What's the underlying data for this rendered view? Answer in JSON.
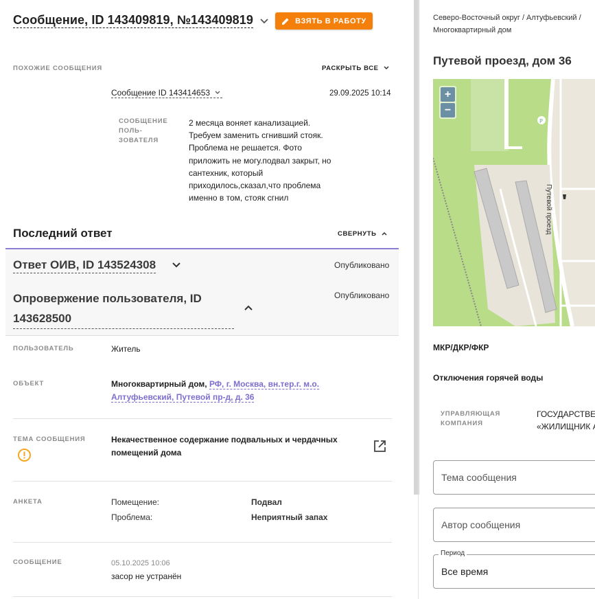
{
  "header": {
    "title": "Сообщение, ID 143409819, №143409819",
    "take_button": "ВЗЯТЬ В РАБОТУ"
  },
  "similar": {
    "label": "ПОХОЖИЕ СООБЩЕНИЯ",
    "expand_all": "РАСКРЫТЬ ВСЕ",
    "item_link": "Сообщение ID 143414653",
    "item_date": "29.09.2025 10:14",
    "user_msg_label": "СООБЩЕНИЕ ПОЛЬ-ЗОВАТЕЛЯ",
    "user_msg_text": "2 месяца воняет канализацией. Требуем заменить сгнивший стояк. Проблема не решается. Фото приложить не могу.подвал закрыт, но сантехник, который приходилось,сказал,что проблема именно в том, стояк сгнил"
  },
  "last_answer": {
    "title": "Последний ответ",
    "collapse": "СВЕРНУТЬ",
    "answer1_title": "Ответ ОИВ, ID 143524308",
    "answer1_status": "Опубликовано",
    "answer2_title": "Опровержение пользователя, ID 143628500",
    "answer2_status": "Опубликовано"
  },
  "details": {
    "user_label": "ПОЛЬЗОВАТЕЛЬ",
    "user_value": "Житель",
    "object_label": "ОБЪЕКТ",
    "object_type": "Многоквартирный дом, ",
    "object_address": "РФ, г. Москва, вн.тер.г. м.о. Алтуфьевский, Путевой пр-д, д. 36",
    "topic_label": "ТЕМА СООБЩЕНИЯ",
    "topic_value": "Некачественное содержание подвальных и чердачных помещений дома",
    "survey_label": "АНКЕТА",
    "survey_key1": "Помещение:",
    "survey_val1": "Подвал",
    "survey_key2": "Проблема:",
    "survey_val2": "Неприятный запах",
    "message_label": "СООБЩЕНИЕ",
    "message_date": "05.10.2025 10:06",
    "message_text": "засор не устранён"
  },
  "right": {
    "breadcrumb": "Северо-Восточный округ / Алтуфьевский / Многоквартирный дом",
    "address": "Путевой проезд, дом 36",
    "map_street": "Путевой проезд",
    "zoom_in": "+",
    "zoom_out": "−",
    "mkr": "МКР/ДКР/ФКР",
    "hot_water": "Отключения горячей воды",
    "mgmt_label": "УПРАВЛЯЮЩАЯ КОМПАНИЯ",
    "mgmt_value_line1": "ГОСУДАРСТВЕ",
    "mgmt_value_line2": "«ЖИЛИЩНИК А",
    "topic_placeholder": "Тема сообщения",
    "author_placeholder": "Автор сообщения",
    "period_label": "Период",
    "period_value": "Все время"
  },
  "colors": {
    "accent_orange": "#f47f0a",
    "link_purple": "#7d6fcf",
    "warning": "#f5a623"
  }
}
